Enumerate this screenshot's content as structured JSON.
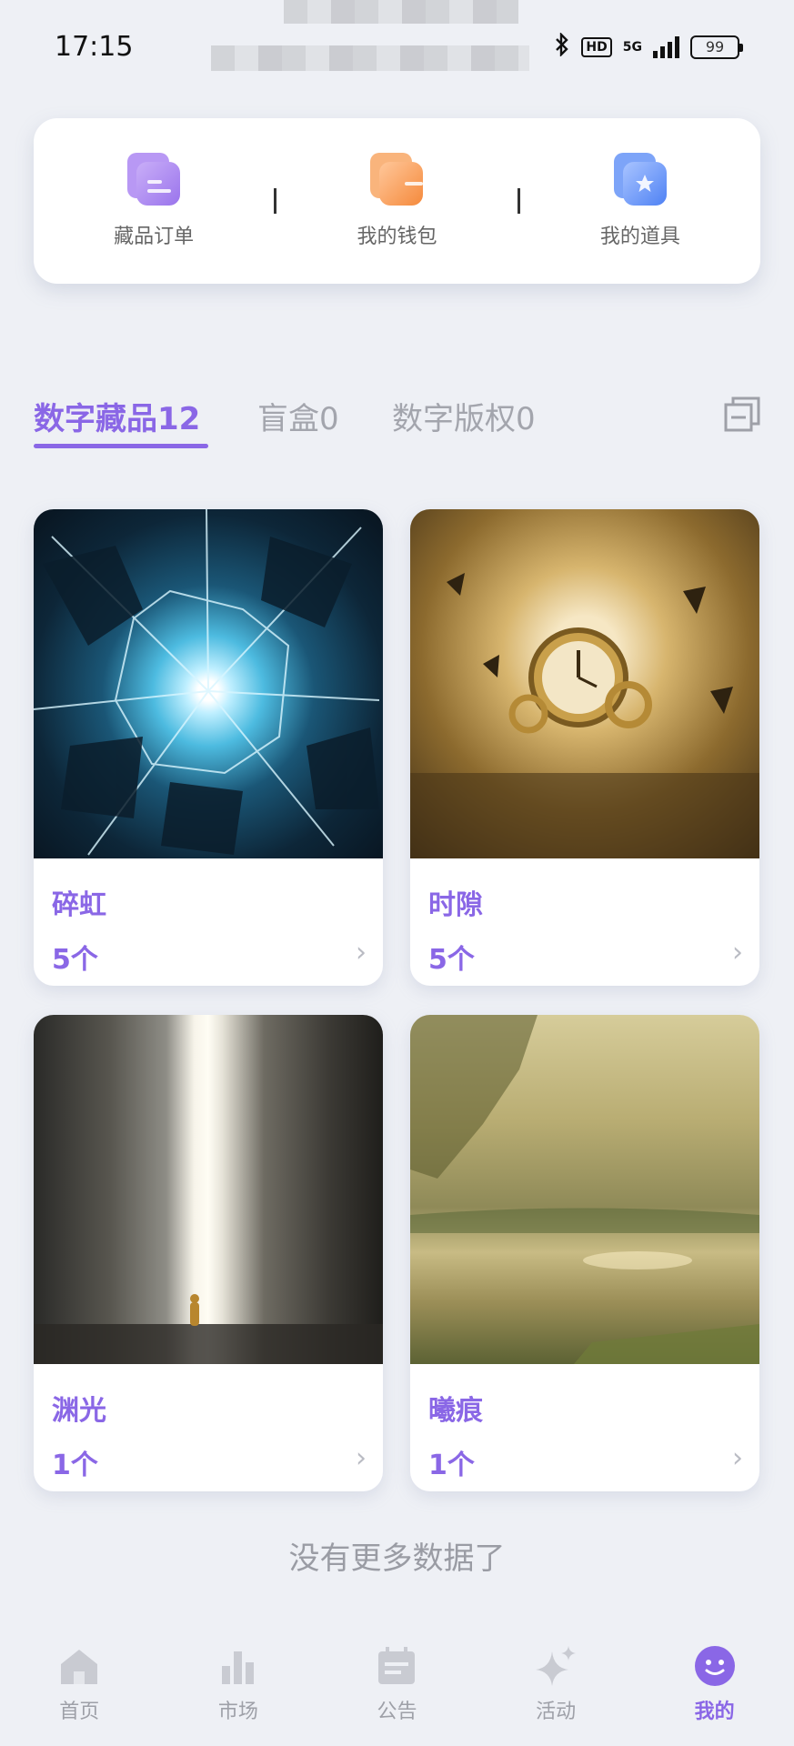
{
  "status_bar": {
    "time": "17:15",
    "battery": "99",
    "network": "5G",
    "hd": "HD"
  },
  "quick_actions": [
    {
      "label": "藏品订单",
      "icon": "orders-icon"
    },
    {
      "label": "我的钱包",
      "icon": "wallet-icon"
    },
    {
      "label": "我的道具",
      "icon": "props-star-icon"
    }
  ],
  "tabs": [
    {
      "label": "数字藏品12",
      "active": true
    },
    {
      "label": "盲盒0",
      "active": false
    },
    {
      "label": "数字版权0",
      "active": false
    }
  ],
  "collections": [
    {
      "title": "碎虹",
      "count": "5个",
      "image": "shattered-glass-light"
    },
    {
      "title": "时隙",
      "count": "5个",
      "image": "golden-clock-ruins"
    },
    {
      "title": "渊光",
      "count": "1个",
      "image": "canyon-light-figure"
    },
    {
      "title": "曦痕",
      "count": "1个",
      "image": "sunlit-lake-forest"
    }
  ],
  "no_more_text": "没有更多数据了",
  "bottom_nav": [
    {
      "label": "首页",
      "icon": "home-icon",
      "active": false
    },
    {
      "label": "市场",
      "icon": "market-bars-icon",
      "active": false
    },
    {
      "label": "公告",
      "icon": "announcement-icon",
      "active": false
    },
    {
      "label": "活动",
      "icon": "sparkle-icon",
      "active": false
    },
    {
      "label": "我的",
      "icon": "profile-smile-icon",
      "active": true
    }
  ],
  "colors": {
    "accent": "#8a67e6",
    "inactive": "#9ea0a8",
    "background": "#eef0f5"
  }
}
